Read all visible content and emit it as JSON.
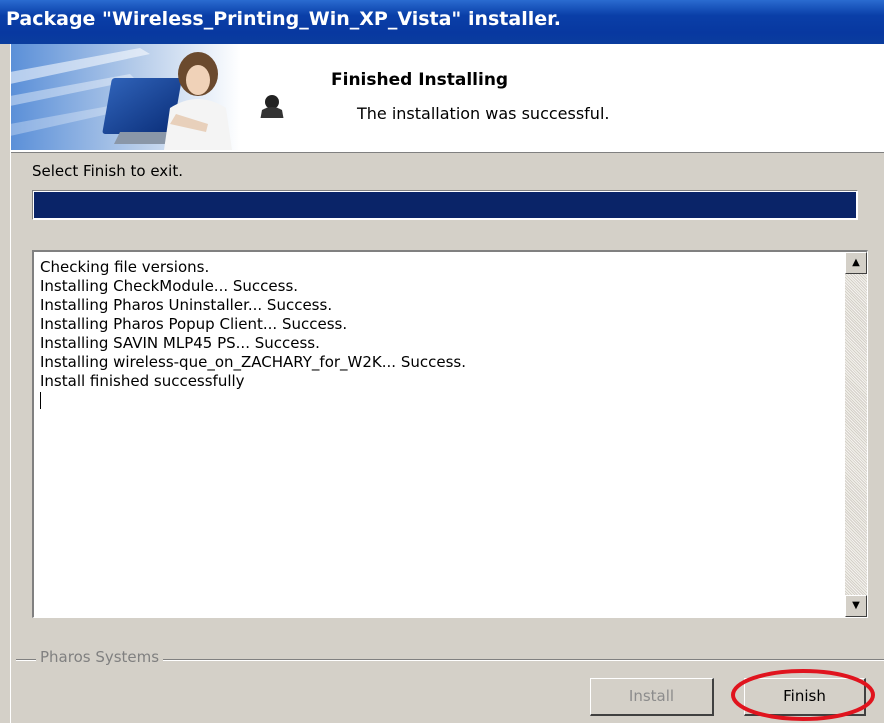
{
  "window": {
    "title": "Package \"Wireless_Printing_Win_XP_Vista\" installer."
  },
  "header": {
    "heading": "Finished Installing",
    "subheading": "The installation was successful."
  },
  "instruction": "Select Finish to exit.",
  "progress": {
    "fraction": 1.0,
    "fill_color": "#0a2468"
  },
  "log": {
    "lines": [
      "Checking file versions.",
      "Installing CheckModule... Success.",
      "Installing Pharos Uninstaller... Success.",
      "Installing Pharos Popup Client... Success.",
      "Installing SAVIN MLP45 PS... Success.",
      "Installing wireless-que_on_ZACHARY_for_W2K... Success.",
      "Install finished successfully"
    ]
  },
  "footer": {
    "company": "Pharos Systems",
    "install_label": "Install",
    "finish_label": "Finish"
  },
  "colors": {
    "titlebar": "#0a3fa8",
    "annotation": "#e0141e"
  },
  "icons": {
    "scroll_up": "triangle-up",
    "scroll_down": "triangle-down"
  }
}
